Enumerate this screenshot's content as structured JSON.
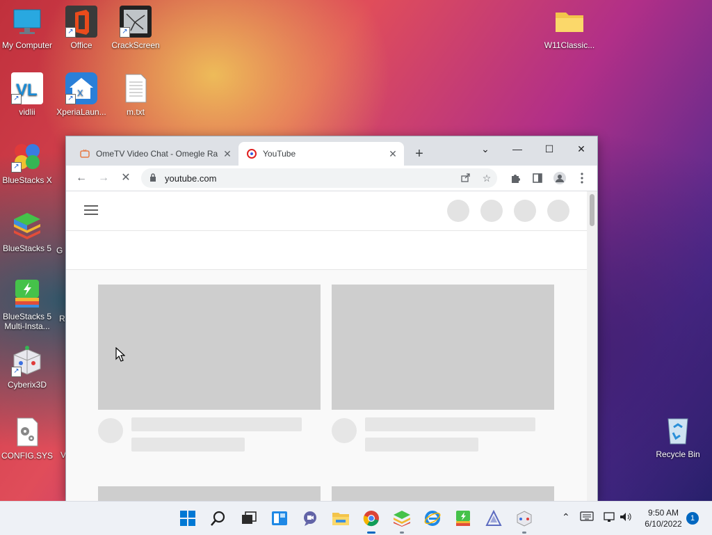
{
  "desktop": {
    "icons": [
      {
        "id": "my-computer",
        "label": "My Computer",
        "icon": "monitor-icon"
      },
      {
        "id": "office",
        "label": "Office",
        "icon": "office-icon"
      },
      {
        "id": "crackscreen",
        "label": "CrackScreen",
        "icon": "cracked-phone-icon"
      },
      {
        "id": "w11classic",
        "label": "W11Classic...",
        "icon": "folder-icon"
      },
      {
        "id": "vidlii",
        "label": "vidlii",
        "icon": "vidlii-icon"
      },
      {
        "id": "xperia",
        "label": "XperiaLaun...",
        "icon": "xperia-launcher-icon"
      },
      {
        "id": "mtxt",
        "label": "m.txt",
        "icon": "text-file-icon"
      },
      {
        "id": "bluestacks-x",
        "label": "BlueStacks X",
        "icon": "bluestacks-x-icon"
      },
      {
        "id": "bluestacks5",
        "label": "BlueStacks 5",
        "icon": "bluestacks-icon"
      },
      {
        "id": "bluestacks5-multi",
        "label": "BlueStacks 5 Multi-Insta...",
        "icon": "bluestacks-multi-instance-icon"
      },
      {
        "id": "cyberix3d",
        "label": "Cyberix3D",
        "icon": "cyberix3d-icon"
      },
      {
        "id": "config-sys",
        "label": "CONFIG.SYS",
        "icon": "config-file-icon"
      },
      {
        "id": "recycle-bin",
        "label": "Recycle Bin",
        "icon": "recycle-bin-icon"
      }
    ],
    "partial_labels": [
      "G",
      "R",
      "V"
    ]
  },
  "browser": {
    "tabs": [
      {
        "title": "OmeTV Video Chat - Omegle Ra",
        "close": "✕",
        "active": false,
        "favicon": "ometv-favicon-icon"
      },
      {
        "title": "YouTube",
        "close": "✕",
        "active": true,
        "favicon": "youtube-favicon-icon"
      }
    ],
    "new_tab": "+",
    "window_controls": {
      "dropdown": "⌄",
      "minimize": "—",
      "maximize": "☐",
      "close": "✕"
    },
    "nav": {
      "back": "←",
      "forward": "→",
      "stop": "✕"
    },
    "address": {
      "url": "youtube.com"
    },
    "toolbar_icons": [
      "share-icon",
      "bookmark-star-icon",
      "extensions-icon",
      "side-panel-icon",
      "profile-icon",
      "menu-icon"
    ]
  },
  "page": {
    "site": "YouTube",
    "state": "loading-skeleton"
  },
  "taskbar": {
    "apps": [
      "start-icon",
      "search-icon",
      "task-view-icon",
      "widgets-icon",
      "teams-chat-icon",
      "file-explorer-icon",
      "chrome-icon",
      "bluestacks-icon",
      "internet-explorer-icon",
      "bluestacks-multi-instance-icon",
      "aurora-icon",
      "cyberix3d-icon"
    ],
    "tray_chevron": "⌃",
    "time": "9:50 AM",
    "date": "6/10/2022",
    "notification_count": "1"
  }
}
